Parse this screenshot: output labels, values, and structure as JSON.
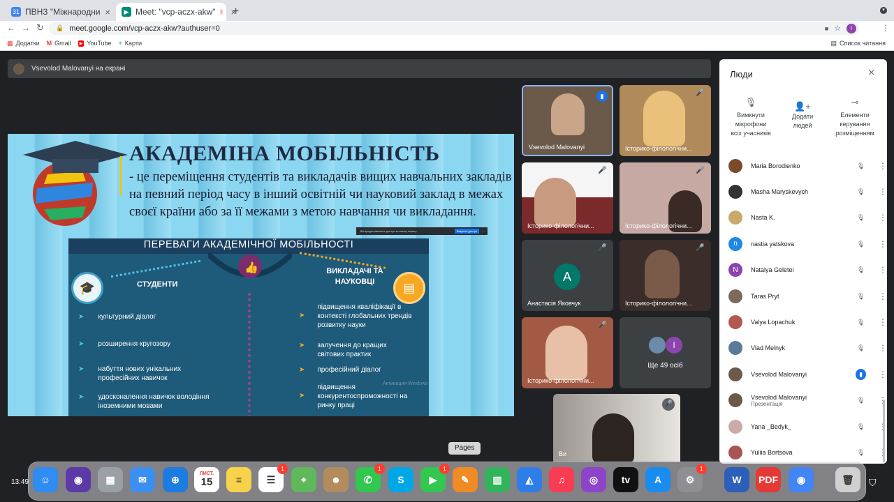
{
  "browser": {
    "tabs": [
      {
        "title": "ПВНЗ \"Міжнародний економ",
        "favicon": "calendar-icon"
      },
      {
        "title": "Meet: \"vcp-aczx-akw\"",
        "favicon": "meet-icon"
      }
    ],
    "url": "meet.google.com/vcp-aczx-akw?authuser=0",
    "bookmarks": [
      "Додатки",
      "Gmail",
      "YouTube",
      "Карти"
    ],
    "reading_list": "Список читання",
    "profile_initial": "I"
  },
  "banner": {
    "text": "Vsevolod Malovanyi на екрані"
  },
  "slide": {
    "title": "АКАДЕМІНА МОБІЛЬНІСТЬ",
    "definition": "- це переміщення студентів та викладачів вищих навчальних закладів на певний період часу в інший освітній чи науковий заклад в межах своєї країни або за її межами з метою навчання чи викладання.",
    "share_notice": "Ви предоставляете доступ ко всему экрану.",
    "share_stop": "Закрыть доступ",
    "banner": "ПЕРЕВАГИ АКАДЕМІЧНОЇ МОБІЛЬНОСТІ",
    "students_heading": "СТУДЕНТИ",
    "teachers_heading": "ВИКЛАДАЧІ ТА НАУКОВЦІ",
    "students": [
      "культурний діалог",
      "розширення кругозору",
      "набуття нових унікальних професійних навичок",
      "удосконалення навичок володіння іноземними мовами"
    ],
    "teachers": [
      "підвищення кваліфікації в контексті глобальних трендів розвитку науки",
      "залучення до кращих світових практик",
      "професійний діалог",
      "підвищення конкурентоспроможності на ринку праці"
    ],
    "watermark": "Активация Windows"
  },
  "tiles": [
    {
      "name": "Vsevolod Malovanyi",
      "bg": "#6b5a4a"
    },
    {
      "name": "Історико-філологічни...",
      "bg": "#b08a5a"
    },
    {
      "name": "Історико-філологічни...",
      "bg": "#7a2a2a"
    },
    {
      "name": "Історико-філологічни...",
      "bg": "#c7a9a4"
    },
    {
      "name": "Анастасія Яковчук",
      "avatar": "A",
      "bg": "#3c4043"
    },
    {
      "name": "Історико-філологічни...",
      "bg": "#3a2d2a"
    },
    {
      "name": "Історико-філологічни...",
      "bg": "#a35a45"
    },
    {
      "name": "Ще 49 осіб",
      "avatar": "I",
      "bg": "#3c4043"
    },
    {
      "name": "Ви",
      "bg": "#8a8580"
    }
  ],
  "people_panel": {
    "title": "Люди",
    "actions": [
      "Вимкнути мікрофони всіх учасників",
      "Додати людей",
      "Елементи керування розміщенням"
    ],
    "people": [
      {
        "name": "Maria Borodienko",
        "color": "#7b4a2a"
      },
      {
        "name": "Masha Maryskevych",
        "color": "#333333"
      },
      {
        "name": "Nasta K.",
        "color": "#c9a96e"
      },
      {
        "name": "nastia yatskova",
        "initial": "n",
        "color": "#1e88e5"
      },
      {
        "name": "Natalya Geletei",
        "initial": "N",
        "color": "#8e44ad"
      },
      {
        "name": "Taras Pryt",
        "color": "#7d6a5a"
      },
      {
        "name": "Valya Lopachuk",
        "color": "#b25a50"
      },
      {
        "name": "Vlad Melnyk",
        "color": "#5a7a9a"
      },
      {
        "name": "Vsevolod Malovanyi",
        "color": "#6b5a4a",
        "speaking": true
      },
      {
        "name": "Vsevolod Malovanyi",
        "sub": "Презентація",
        "color": "#6b5a4a"
      },
      {
        "name": "Yana _Bedyk_",
        "color": "#caa"
      },
      {
        "name": "Yuliia Bortsova",
        "color": "#a55"
      }
    ]
  },
  "tooltip": "Pages",
  "clock": "13:49",
  "dock": [
    {
      "name": "finder",
      "color": "#2f8cf0",
      "glyph": "☺"
    },
    {
      "name": "siri",
      "color": "#5b3aa8",
      "glyph": "◉"
    },
    {
      "name": "launchpad",
      "color": "#9aa0a6",
      "glyph": "▦"
    },
    {
      "name": "mail",
      "color": "#3b8ff0",
      "glyph": "✉"
    },
    {
      "name": "safari",
      "color": "#1c7ce0",
      "glyph": "⊕"
    },
    {
      "name": "calendar",
      "color": "#ffffff",
      "glyph": "15",
      "top": "ЛИСТ."
    },
    {
      "name": "notes",
      "color": "#f7d24a",
      "glyph": "≡"
    },
    {
      "name": "reminders",
      "color": "#ffffff",
      "glyph": "☰",
      "badge": "1"
    },
    {
      "name": "maps",
      "color": "#5fb85a",
      "glyph": "⌖"
    },
    {
      "name": "contacts",
      "color": "#b48b5c",
      "glyph": "☻"
    },
    {
      "name": "messages",
      "color": "#32c74f",
      "glyph": "✆",
      "badge": "1"
    },
    {
      "name": "skype",
      "color": "#00a7e6",
      "glyph": "S"
    },
    {
      "name": "facetime",
      "color": "#32c74f",
      "glyph": "▶",
      "badge": "1"
    },
    {
      "name": "pages",
      "color": "#f08a24",
      "glyph": "✎"
    },
    {
      "name": "numbers",
      "color": "#2fb45a",
      "glyph": "▥"
    },
    {
      "name": "keynote",
      "color": "#2d7ee8",
      "glyph": "◭"
    },
    {
      "name": "music",
      "color": "#fa3c52",
      "glyph": "♫"
    },
    {
      "name": "podcasts",
      "color": "#8e44c8",
      "glyph": "◎"
    },
    {
      "name": "tv",
      "color": "#111111",
      "glyph": "tv"
    },
    {
      "name": "app-store",
      "color": "#1a8cf0",
      "glyph": "A"
    },
    {
      "name": "system-preferences",
      "color": "#8e8e93",
      "glyph": "⚙",
      "badge": "1"
    },
    {
      "name": "word",
      "color": "#2b5fb8",
      "glyph": "W"
    },
    {
      "name": "pdf",
      "color": "#e53935",
      "glyph": "PDF"
    },
    {
      "name": "chrome",
      "color": "#4285f4",
      "glyph": "◉"
    },
    {
      "name": "trash",
      "color": "#d0d0d0",
      "glyph": "🗑"
    }
  ]
}
